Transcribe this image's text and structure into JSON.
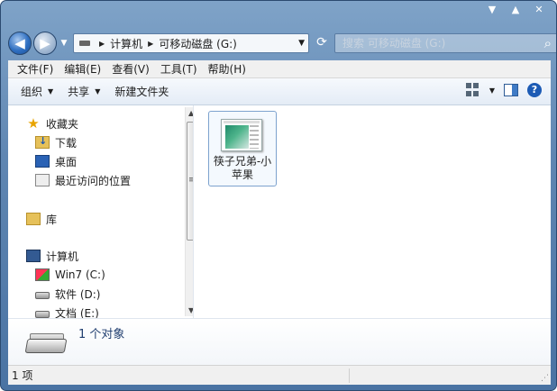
{
  "window": {
    "caption_buttons": [
      "▼",
      "▲",
      "✕"
    ]
  },
  "nav": {
    "back_glyph": "◀",
    "forward_glyph": "▶",
    "recent_glyph": "▼"
  },
  "address": {
    "segments": [
      "计算机",
      "可移动磁盘 (G:)"
    ],
    "dropdown_glyph": "▼"
  },
  "search": {
    "placeholder": "搜索 可移动磁盘 (G:)"
  },
  "menu": {
    "items": [
      "文件(F)",
      "编辑(E)",
      "查看(V)",
      "工具(T)",
      "帮助(H)"
    ]
  },
  "toolbar": {
    "organize": "组织",
    "share": "共享",
    "new_folder": "新建文件夹",
    "arrow": "▼"
  },
  "navpane": {
    "favorites": "收藏夹",
    "downloads": "下载",
    "desktop": "桌面",
    "recent": "最近访问的位置",
    "libraries": "库",
    "computer": "计算机",
    "drive_c": "Win7 (C:)",
    "drive_d": "软件 (D:)",
    "drive_e": "文档 (E:)"
  },
  "content": {
    "files": [
      {
        "name": "筷子兄弟-小苹果"
      }
    ]
  },
  "details": {
    "count": "1 个对象"
  },
  "status": {
    "count": "1 项"
  },
  "colors": {
    "accent": "#1c5bb5",
    "selection": "#7da2ce"
  }
}
